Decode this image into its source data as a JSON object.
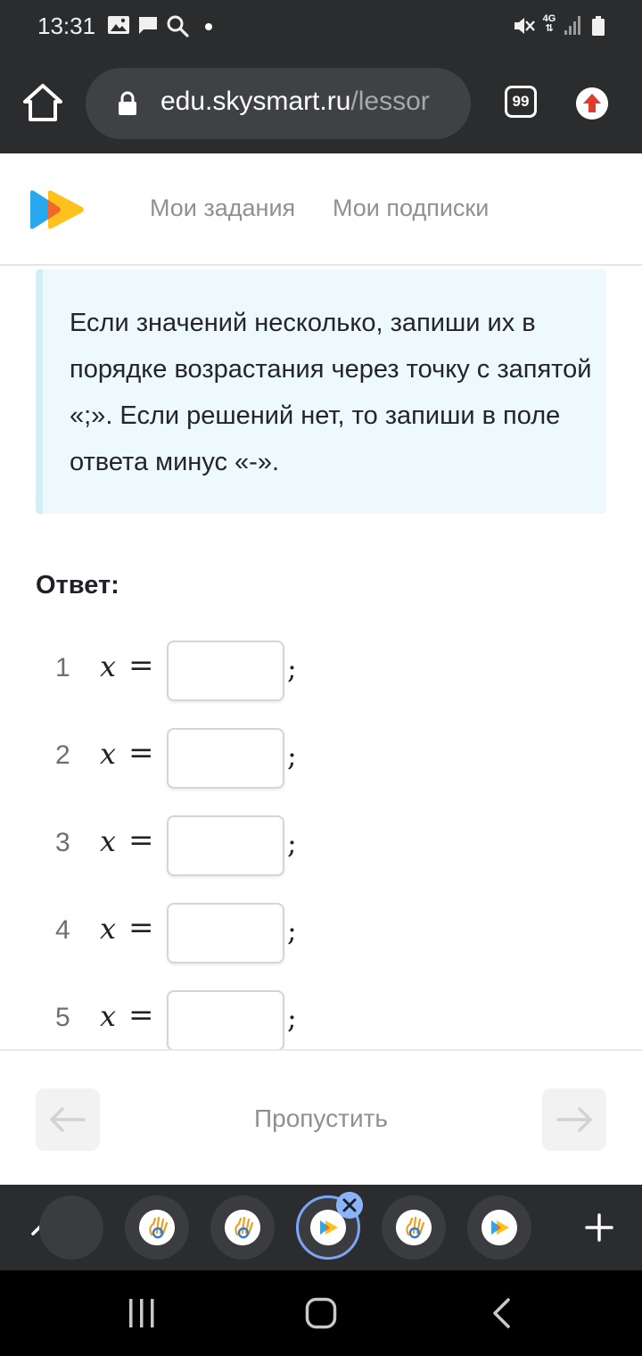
{
  "status_bar": {
    "time": "13:31",
    "network": "4G",
    "icons": [
      "gallery-icon",
      "chat-icon",
      "search-icon",
      "notification-dot",
      "mute-icon",
      "signal-icon",
      "battery-icon"
    ]
  },
  "browser": {
    "url_domain": "edu.skysmart.ru",
    "url_path": "/lessor",
    "tab_count": "99",
    "icons": [
      "home-icon",
      "lock-icon",
      "tabs-icon",
      "upload-icon"
    ]
  },
  "site": {
    "nav": {
      "tasks": "Мои задания",
      "subscriptions": "Мои подписки"
    }
  },
  "info_box": {
    "text": "Если значений несколько, запиши их в порядке возрастания через точку с запятой «;». Если решений нет, то запиши в поле ответа минус «-»."
  },
  "answer": {
    "label": "Ответ:",
    "rows": [
      {
        "num": "1",
        "var": "x",
        "eq": "=",
        "value": "",
        "sep": ";"
      },
      {
        "num": "2",
        "var": "x",
        "eq": "=",
        "value": "",
        "sep": ";"
      },
      {
        "num": "3",
        "var": "x",
        "eq": "=",
        "value": "",
        "sep": ";"
      },
      {
        "num": "4",
        "var": "x",
        "eq": "=",
        "value": "",
        "sep": ";"
      },
      {
        "num": "5",
        "var": "x",
        "eq": "=",
        "value": "",
        "sep": ";"
      }
    ]
  },
  "footer": {
    "skip_label": "Пропустить"
  },
  "tab_strip": {
    "active_tab_index": 3,
    "tab_favicons": [
      "dnevnik-icon",
      "dnevnik-icon",
      "dnevnik-icon",
      "skysmart-icon",
      "dnevnik-icon",
      "skysmart-icon"
    ]
  },
  "colors": {
    "chrome_bg": "#2b2c2e",
    "info_bg": "#edf9fd",
    "accent_blue": "#8ab4f8",
    "upload_red": "#e23a2d"
  }
}
